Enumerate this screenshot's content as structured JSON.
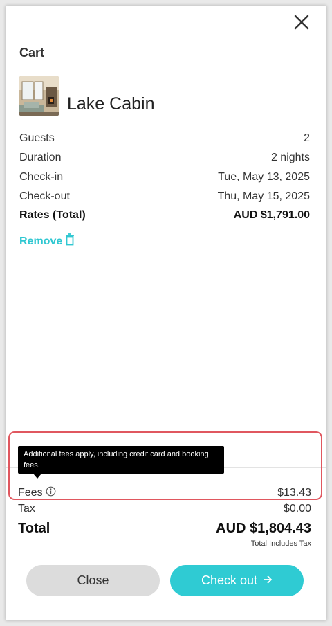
{
  "cart": {
    "title": "Cart",
    "property_name": "Lake Cabin",
    "details": [
      {
        "label": "Guests",
        "value": "2"
      },
      {
        "label": "Duration",
        "value": "2 nights"
      },
      {
        "label": "Check-in",
        "value": "Tue, May 13, 2025"
      },
      {
        "label": "Check-out",
        "value": "Thu, May 15, 2025"
      },
      {
        "label": "Rates (Total)",
        "value": "AUD $1,791.00"
      }
    ],
    "remove_label": "Remove"
  },
  "tooltip": {
    "text": "Additional fees apply, including credit card and booking fees."
  },
  "summary": {
    "fees_label": "Fees",
    "fees_value": "$13.43",
    "tax_label": "Tax",
    "tax_value": "$0.00",
    "total_label": "Total",
    "total_value": "AUD $1,804.43",
    "tax_note": "Total Includes Tax"
  },
  "buttons": {
    "close_label": "Close",
    "checkout_label": "Check out"
  },
  "icons": {
    "close": "close-icon",
    "remove": "trash-icon",
    "info": "info-icon",
    "arrow": "arrow-right-icon"
  },
  "colors": {
    "accent": "#2fcbd3",
    "highlight": "#e0575f"
  }
}
